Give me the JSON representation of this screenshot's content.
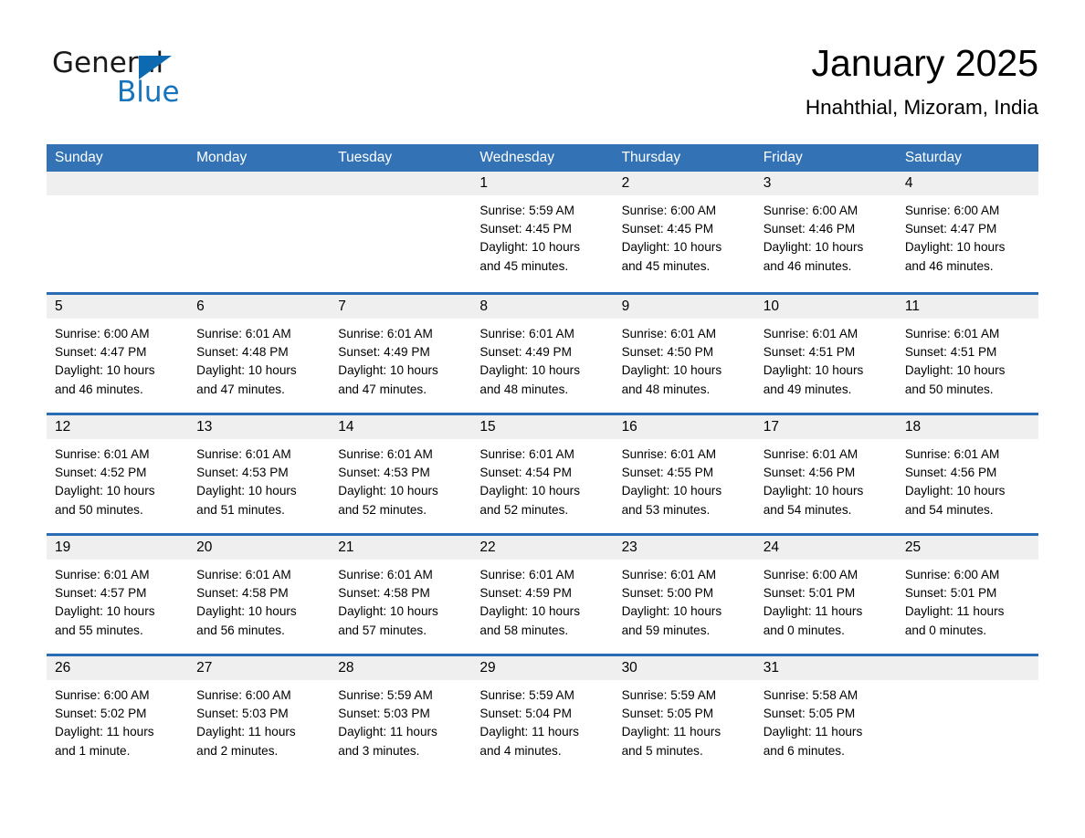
{
  "brand": {
    "name_part1": "General",
    "name_part2": "Blue",
    "triangle_color": "#0d6ab0",
    "blue_color": "#1673bd"
  },
  "header": {
    "month_title": "January 2025",
    "location": "Hnahthial, Mizoram, India"
  },
  "theme": {
    "header_blue": "#3272b5",
    "row_divider_blue": "#2a6db5",
    "day_number_band": "#efefef"
  },
  "weekdays": [
    "Sunday",
    "Monday",
    "Tuesday",
    "Wednesday",
    "Thursday",
    "Friday",
    "Saturday"
  ],
  "weeks": [
    [
      {
        "day": "",
        "empty": true
      },
      {
        "day": "",
        "empty": true
      },
      {
        "day": "",
        "empty": true
      },
      {
        "day": "1",
        "sunrise": "Sunrise: 5:59 AM",
        "sunset": "Sunset: 4:45 PM",
        "daylight_line1": "Daylight: 10 hours",
        "daylight_line2": "and 45 minutes."
      },
      {
        "day": "2",
        "sunrise": "Sunrise: 6:00 AM",
        "sunset": "Sunset: 4:45 PM",
        "daylight_line1": "Daylight: 10 hours",
        "daylight_line2": "and 45 minutes."
      },
      {
        "day": "3",
        "sunrise": "Sunrise: 6:00 AM",
        "sunset": "Sunset: 4:46 PM",
        "daylight_line1": "Daylight: 10 hours",
        "daylight_line2": "and 46 minutes."
      },
      {
        "day": "4",
        "sunrise": "Sunrise: 6:00 AM",
        "sunset": "Sunset: 4:47 PM",
        "daylight_line1": "Daylight: 10 hours",
        "daylight_line2": "and 46 minutes."
      }
    ],
    [
      {
        "day": "5",
        "sunrise": "Sunrise: 6:00 AM",
        "sunset": "Sunset: 4:47 PM",
        "daylight_line1": "Daylight: 10 hours",
        "daylight_line2": "and 46 minutes."
      },
      {
        "day": "6",
        "sunrise": "Sunrise: 6:01 AM",
        "sunset": "Sunset: 4:48 PM",
        "daylight_line1": "Daylight: 10 hours",
        "daylight_line2": "and 47 minutes."
      },
      {
        "day": "7",
        "sunrise": "Sunrise: 6:01 AM",
        "sunset": "Sunset: 4:49 PM",
        "daylight_line1": "Daylight: 10 hours",
        "daylight_line2": "and 47 minutes."
      },
      {
        "day": "8",
        "sunrise": "Sunrise: 6:01 AM",
        "sunset": "Sunset: 4:49 PM",
        "daylight_line1": "Daylight: 10 hours",
        "daylight_line2": "and 48 minutes."
      },
      {
        "day": "9",
        "sunrise": "Sunrise: 6:01 AM",
        "sunset": "Sunset: 4:50 PM",
        "daylight_line1": "Daylight: 10 hours",
        "daylight_line2": "and 48 minutes."
      },
      {
        "day": "10",
        "sunrise": "Sunrise: 6:01 AM",
        "sunset": "Sunset: 4:51 PM",
        "daylight_line1": "Daylight: 10 hours",
        "daylight_line2": "and 49 minutes."
      },
      {
        "day": "11",
        "sunrise": "Sunrise: 6:01 AM",
        "sunset": "Sunset: 4:51 PM",
        "daylight_line1": "Daylight: 10 hours",
        "daylight_line2": "and 50 minutes."
      }
    ],
    [
      {
        "day": "12",
        "sunrise": "Sunrise: 6:01 AM",
        "sunset": "Sunset: 4:52 PM",
        "daylight_line1": "Daylight: 10 hours",
        "daylight_line2": "and 50 minutes."
      },
      {
        "day": "13",
        "sunrise": "Sunrise: 6:01 AM",
        "sunset": "Sunset: 4:53 PM",
        "daylight_line1": "Daylight: 10 hours",
        "daylight_line2": "and 51 minutes."
      },
      {
        "day": "14",
        "sunrise": "Sunrise: 6:01 AM",
        "sunset": "Sunset: 4:53 PM",
        "daylight_line1": "Daylight: 10 hours",
        "daylight_line2": "and 52 minutes."
      },
      {
        "day": "15",
        "sunrise": "Sunrise: 6:01 AM",
        "sunset": "Sunset: 4:54 PM",
        "daylight_line1": "Daylight: 10 hours",
        "daylight_line2": "and 52 minutes."
      },
      {
        "day": "16",
        "sunrise": "Sunrise: 6:01 AM",
        "sunset": "Sunset: 4:55 PM",
        "daylight_line1": "Daylight: 10 hours",
        "daylight_line2": "and 53 minutes."
      },
      {
        "day": "17",
        "sunrise": "Sunrise: 6:01 AM",
        "sunset": "Sunset: 4:56 PM",
        "daylight_line1": "Daylight: 10 hours",
        "daylight_line2": "and 54 minutes."
      },
      {
        "day": "18",
        "sunrise": "Sunrise: 6:01 AM",
        "sunset": "Sunset: 4:56 PM",
        "daylight_line1": "Daylight: 10 hours",
        "daylight_line2": "and 54 minutes."
      }
    ],
    [
      {
        "day": "19",
        "sunrise": "Sunrise: 6:01 AM",
        "sunset": "Sunset: 4:57 PM",
        "daylight_line1": "Daylight: 10 hours",
        "daylight_line2": "and 55 minutes."
      },
      {
        "day": "20",
        "sunrise": "Sunrise: 6:01 AM",
        "sunset": "Sunset: 4:58 PM",
        "daylight_line1": "Daylight: 10 hours",
        "daylight_line2": "and 56 minutes."
      },
      {
        "day": "21",
        "sunrise": "Sunrise: 6:01 AM",
        "sunset": "Sunset: 4:58 PM",
        "daylight_line1": "Daylight: 10 hours",
        "daylight_line2": "and 57 minutes."
      },
      {
        "day": "22",
        "sunrise": "Sunrise: 6:01 AM",
        "sunset": "Sunset: 4:59 PM",
        "daylight_line1": "Daylight: 10 hours",
        "daylight_line2": "and 58 minutes."
      },
      {
        "day": "23",
        "sunrise": "Sunrise: 6:01 AM",
        "sunset": "Sunset: 5:00 PM",
        "daylight_line1": "Daylight: 10 hours",
        "daylight_line2": "and 59 minutes."
      },
      {
        "day": "24",
        "sunrise": "Sunrise: 6:00 AM",
        "sunset": "Sunset: 5:01 PM",
        "daylight_line1": "Daylight: 11 hours",
        "daylight_line2": "and 0 minutes."
      },
      {
        "day": "25",
        "sunrise": "Sunrise: 6:00 AM",
        "sunset": "Sunset: 5:01 PM",
        "daylight_line1": "Daylight: 11 hours",
        "daylight_line2": "and 0 minutes."
      }
    ],
    [
      {
        "day": "26",
        "sunrise": "Sunrise: 6:00 AM",
        "sunset": "Sunset: 5:02 PM",
        "daylight_line1": "Daylight: 11 hours",
        "daylight_line2": "and 1 minute."
      },
      {
        "day": "27",
        "sunrise": "Sunrise: 6:00 AM",
        "sunset": "Sunset: 5:03 PM",
        "daylight_line1": "Daylight: 11 hours",
        "daylight_line2": "and 2 minutes."
      },
      {
        "day": "28",
        "sunrise": "Sunrise: 5:59 AM",
        "sunset": "Sunset: 5:03 PM",
        "daylight_line1": "Daylight: 11 hours",
        "daylight_line2": "and 3 minutes."
      },
      {
        "day": "29",
        "sunrise": "Sunrise: 5:59 AM",
        "sunset": "Sunset: 5:04 PM",
        "daylight_line1": "Daylight: 11 hours",
        "daylight_line2": "and 4 minutes."
      },
      {
        "day": "30",
        "sunrise": "Sunrise: 5:59 AM",
        "sunset": "Sunset: 5:05 PM",
        "daylight_line1": "Daylight: 11 hours",
        "daylight_line2": "and 5 minutes."
      },
      {
        "day": "31",
        "sunrise": "Sunrise: 5:58 AM",
        "sunset": "Sunset: 5:05 PM",
        "daylight_line1": "Daylight: 11 hours",
        "daylight_line2": "and 6 minutes."
      },
      {
        "day": "",
        "empty": true
      }
    ]
  ]
}
